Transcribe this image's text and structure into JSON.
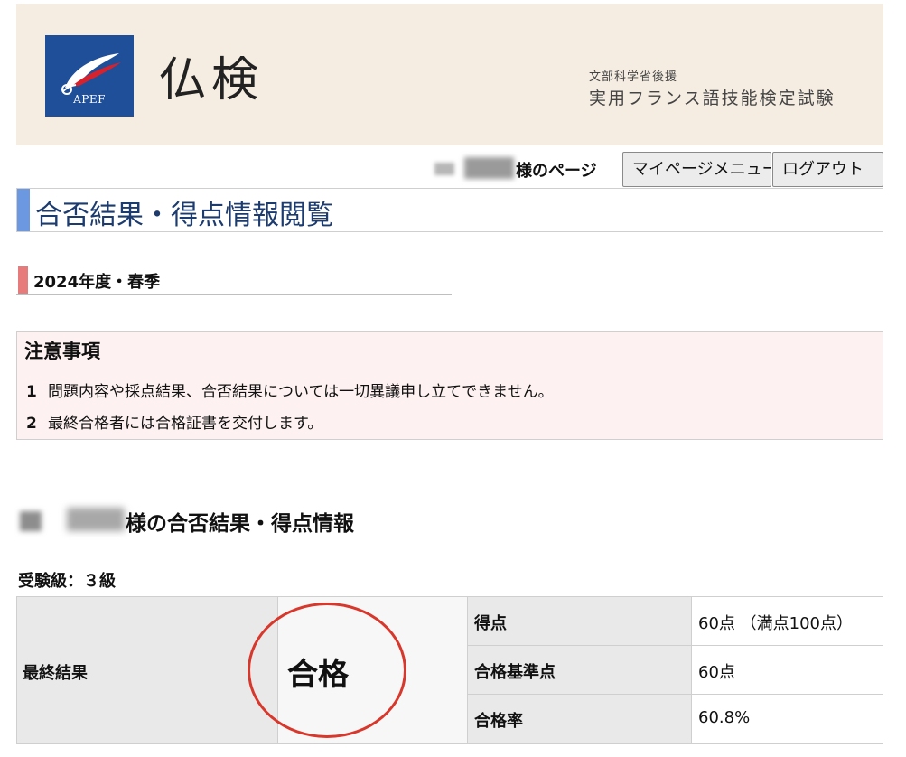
{
  "header": {
    "logo_text": "APEF",
    "site_title": "仏検",
    "sponsor": "文部科学省後援",
    "organization": "実用フランス語技能検定試験"
  },
  "user_bar": {
    "page_label": "様のページ",
    "mypage_button": "マイページメニュー",
    "logout_button": "ログアウト"
  },
  "page": {
    "heading": "合否結果・得点情報閲覧",
    "section_title": "2024年度・春季"
  },
  "notice": {
    "title": "注意事項",
    "items": [
      {
        "num": "1",
        "text": "問題内容や採点結果、合否結果については一切異議申し立てできません。"
      },
      {
        "num": "2",
        "text": "最終合格者には合格証書を交付します。"
      }
    ]
  },
  "result": {
    "heading_suffix": "様の合否結果・得点情報",
    "grade_label": "受験級：３級",
    "final_label": "最終結果",
    "final_value": "合格",
    "rows": [
      {
        "label": "得点",
        "value": "60点 （満点100点）"
      },
      {
        "label": "合格基準点",
        "value": "60点"
      },
      {
        "label": "合格率",
        "value": "60.8%"
      }
    ]
  },
  "colors": {
    "header_bg": "#f5ede2",
    "logo_bg": "#1f4f99",
    "heading_accent": "#6c97e1",
    "section_accent": "#e77a7a",
    "notice_bg": "#fdf2f1",
    "stamp": "#d8372c"
  }
}
